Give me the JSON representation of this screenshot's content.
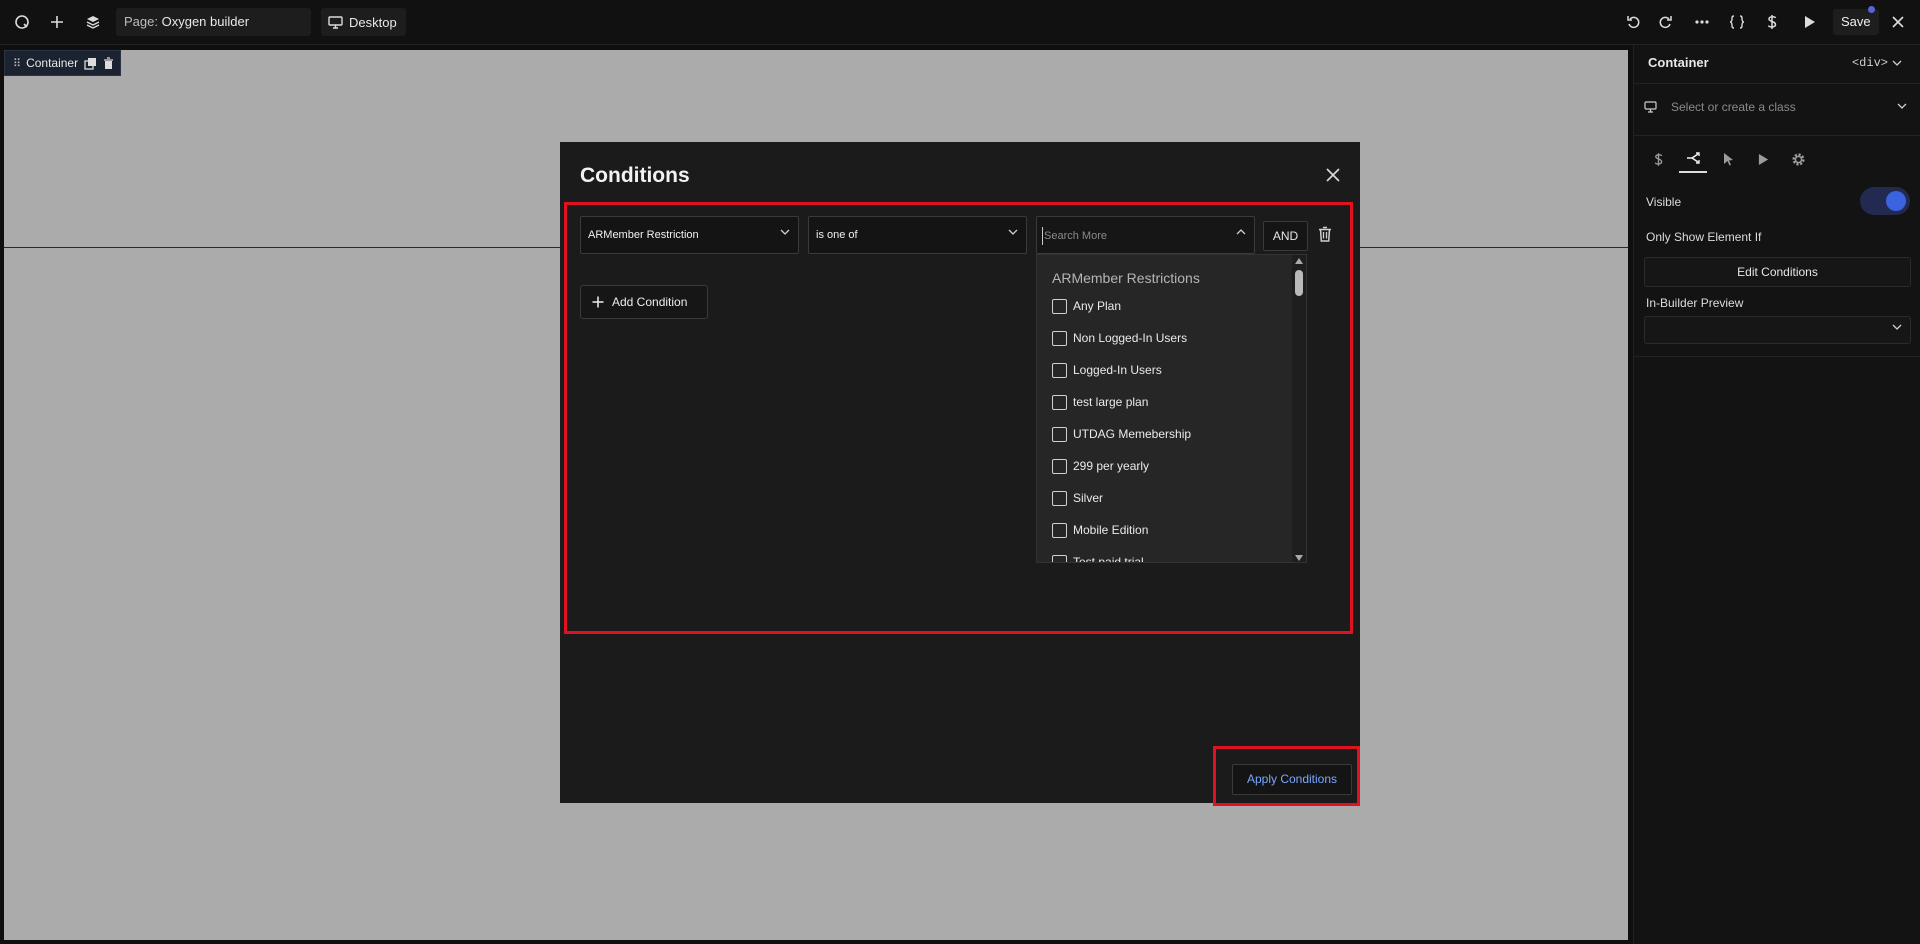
{
  "topbar": {
    "page_label": "Page:",
    "page_name": "Oxygen builder",
    "device": "Desktop",
    "save_label": "Save"
  },
  "canvas": {
    "selected_element": "Container"
  },
  "panel": {
    "title": "Container",
    "tag": "<div>",
    "class_placeholder": "Select or create a class",
    "visible_label": "Visible",
    "visible_on": true,
    "only_show_label": "Only Show Element If",
    "edit_conditions_label": "Edit Conditions",
    "in_builder_preview_label": "In-Builder Preview",
    "in_builder_preview_value": ""
  },
  "modal": {
    "title": "Conditions",
    "condition": {
      "type": "ARMember Restriction",
      "operator": "is one of",
      "search_placeholder": "Search More",
      "logic": "AND"
    },
    "add_condition_label": "Add Condition",
    "apply_label": "Apply Conditions",
    "dropdown": {
      "header": "ARMember Restrictions",
      "items": [
        "Any Plan",
        "Non Logged-In Users",
        "Logged-In Users",
        "test large plan",
        "UTDAG Memebership",
        "299 per yearly",
        "Silver",
        "Mobile Edition",
        "Test paid trial"
      ]
    }
  },
  "colors": {
    "highlight_red": "#e0121f",
    "accent_blue": "#3b63e0",
    "apply_text": "#78a8ff"
  }
}
